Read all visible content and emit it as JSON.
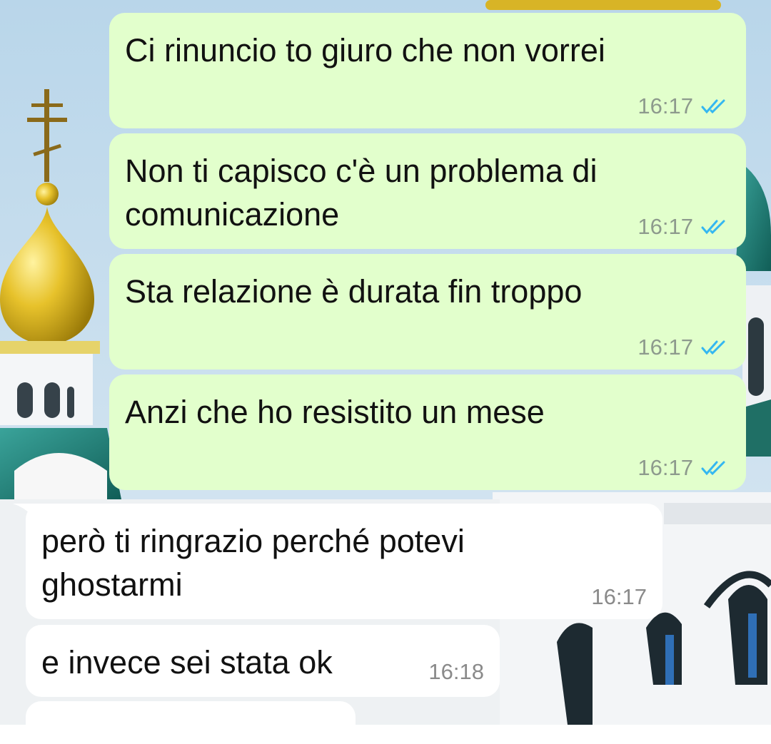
{
  "chat": {
    "messages": [
      {
        "dir": "out",
        "text": "Ci rinuncio to giuro che non vorrei",
        "time": "16:17",
        "status": "read"
      },
      {
        "dir": "out",
        "text": "Non ti capisco c'è un problema di comunicazione",
        "time": "16:17",
        "status": "read"
      },
      {
        "dir": "out",
        "text": "Sta relazione è durata fin troppo",
        "time": "16:17",
        "status": "read"
      },
      {
        "dir": "out",
        "text": "Anzi che ho resistito un mese",
        "time": "16:17",
        "status": "read"
      },
      {
        "dir": "in",
        "text": "però ti ringrazio perché potevi ghostarmi",
        "time": "16:17"
      },
      {
        "dir": "in",
        "text": "e invece sei stata ok",
        "time": "16:18"
      }
    ]
  },
  "colors": {
    "outgoing_bubble": "#e2ffcc",
    "incoming_bubble": "#ffffff",
    "read_ticks": "#34b7f1"
  },
  "icons": {
    "read_receipt": "double-check-icon"
  }
}
